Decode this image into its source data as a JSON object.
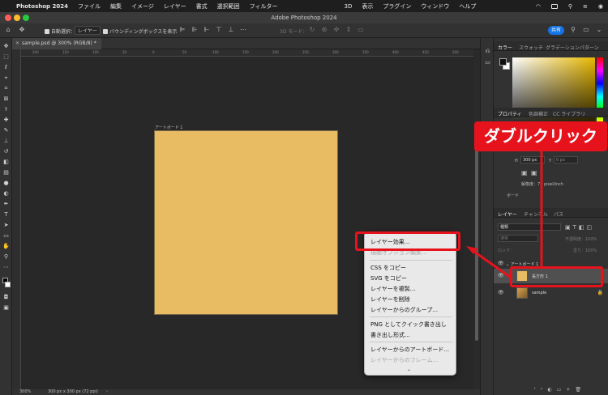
{
  "menubar": {
    "app_name": "Photoshop 2024",
    "items": [
      "ファイル",
      "編集",
      "イメージ",
      "レイヤー",
      "書式",
      "選択範囲",
      "フィルター",
      "3D",
      "表示",
      "プラグイン",
      "ウィンドウ",
      "ヘルプ"
    ]
  },
  "window": {
    "title": "Adobe Photoshop 2024"
  },
  "options_bar": {
    "auto_select_label": "自動選択：",
    "auto_select_target": "レイヤー",
    "bounding_box_label": "バウンディングボックスを表示",
    "mode_3d_label": "3D モード：",
    "share_label": "共有"
  },
  "document": {
    "tab_title": "sample.psd @ 300% (RGB/8) *",
    "artboard_label": "アートボード 1",
    "artboard_color": "#e8bc63",
    "ruler_ticks": [
      "200",
      "150",
      "100",
      "50",
      "0",
      "50",
      "100",
      "150",
      "200",
      "250",
      "300",
      "350",
      "400",
      "450",
      "500"
    ]
  },
  "status": {
    "zoom": "300%",
    "doc_size": "300 px x 300 px (72 ppi)"
  },
  "panels": {
    "color_tabs": [
      "カラー",
      "スウォッチ",
      "グラデーション",
      "パターン"
    ],
    "properties_tabs": [
      "プロパティ",
      "色調補正",
      "CC ライブラリ"
    ],
    "properties": {
      "h_label": "H",
      "h_value": "300 px",
      "y_label": "Y",
      "y_value": "0 px",
      "resolution": "解像度：72 pixel/inch",
      "section": "ボード"
    },
    "layers_tabs": [
      "レイヤー",
      "チャンネル",
      "パス"
    ],
    "layers_filter": "種類",
    "blend_mode": "通常",
    "opacity": "不透明度：100%",
    "lock_label": "ロック：",
    "fill": "塗り：100%",
    "layers": [
      {
        "name": "アートボード 1",
        "type": "group"
      },
      {
        "name": "長方形 1",
        "type": "shape"
      },
      {
        "name": "sample",
        "type": "image"
      }
    ]
  },
  "context_menu": {
    "items": [
      {
        "label": "レイヤー効果...",
        "enabled": true
      },
      {
        "label": "描画オプション編集...",
        "enabled": false
      },
      {
        "label": "CSS をコピー",
        "enabled": true
      },
      {
        "label": "SVG をコピー",
        "enabled": true
      },
      {
        "label": "レイヤーを複製...",
        "enabled": true
      },
      {
        "label": "レイヤーを削除",
        "enabled": true
      },
      {
        "label": "レイヤーからのグループ...",
        "enabled": true
      },
      {
        "label": "PNG としてクイック書き出し",
        "enabled": true
      },
      {
        "label": "書き出し形式...",
        "enabled": true
      },
      {
        "label": "レイヤーからのアートボード...",
        "enabled": true
      },
      {
        "label": "レイヤーからのフレーム...",
        "enabled": false
      }
    ]
  },
  "annotation": {
    "callout": "ダブルクリック",
    "color": "#e6131d"
  }
}
